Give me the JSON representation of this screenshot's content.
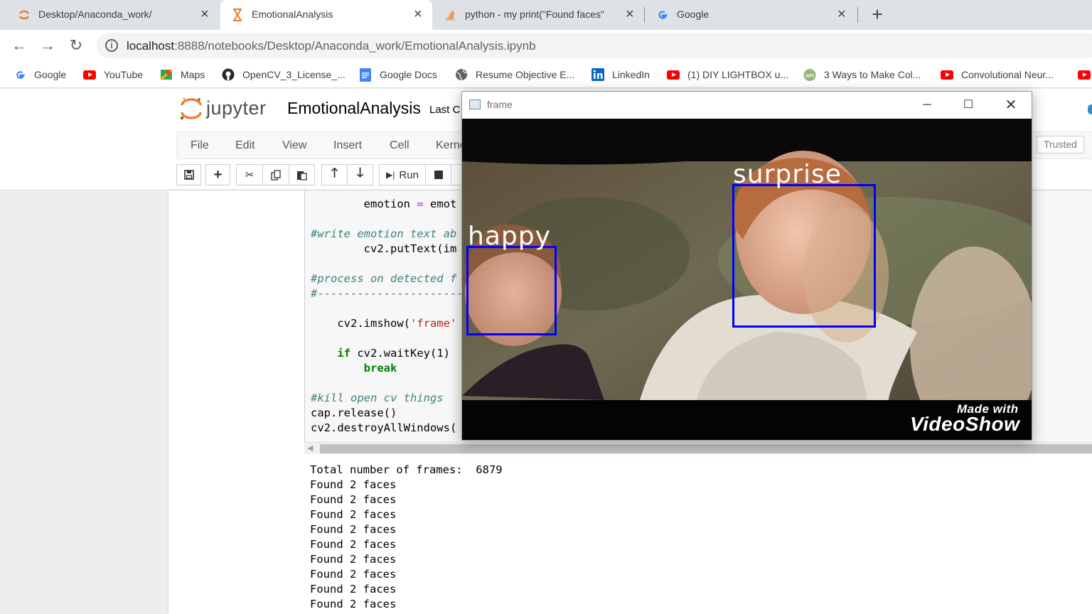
{
  "browser": {
    "tabs": [
      {
        "title": "Desktop/Anaconda_work/",
        "favicon": "jupyter-icon"
      },
      {
        "title": "EmotionalAnalysis",
        "favicon": "hourglass-icon",
        "active": true
      },
      {
        "title": "python - my print(\"Found faces\"",
        "favicon": "stackoverflow-icon"
      },
      {
        "title": "Google",
        "favicon": "google-icon"
      }
    ],
    "url_host": "localhost",
    "url_path": ":8888/notebooks/Desktop/Anaconda_work/EmotionalAnalysis.ipynb",
    "bookmarks": [
      {
        "label": "Google",
        "icon": "google-icon"
      },
      {
        "label": "YouTube",
        "icon": "youtube-icon"
      },
      {
        "label": "Maps",
        "icon": "maps-icon"
      },
      {
        "label": "OpenCV_3_License_...",
        "icon": "github-icon"
      },
      {
        "label": "Google Docs",
        "icon": "docs-icon"
      },
      {
        "label": "Resume Objective E...",
        "icon": "globe-icon"
      },
      {
        "label": "LinkedIn",
        "icon": "linkedin-icon"
      },
      {
        "label": "(1) DIY LIGHTBOX u...",
        "icon": "youtube-icon"
      },
      {
        "label": "3 Ways to Make Col...",
        "icon": "wikihow-icon"
      },
      {
        "label": "Convolutional Neur...",
        "icon": "youtube-icon"
      }
    ]
  },
  "jupyter": {
    "wordmark": "jupyter",
    "notebook_name": "EmotionalAnalysis",
    "checkpoint": "Last C",
    "menu": [
      "File",
      "Edit",
      "View",
      "Insert",
      "Cell",
      "Kerne"
    ],
    "trusted": "Trusted",
    "run_label": "Run"
  },
  "code_lines": [
    {
      "parts": [
        {
          "t": "        emotion "
        },
        {
          "t": "=",
          "c": "op"
        },
        {
          "t": " emot"
        }
      ]
    },
    {
      "parts": [
        {
          "t": "#write emotion text ab",
          "c": "cm"
        }
      ]
    },
    {
      "parts": [
        {
          "t": "        cv2.putText(im"
        }
      ]
    },
    {
      "parts": [
        {
          "t": "#process on detected f",
          "c": "cm"
        }
      ]
    },
    {
      "parts": [
        {
          "t": "#----------------------",
          "c": "cm"
        }
      ]
    },
    {
      "parts": [
        {
          "t": "    cv2.imshow("
        },
        {
          "t": "'frame'",
          "c": "str"
        }
      ]
    },
    {
      "parts": [
        {
          "t": "    "
        },
        {
          "t": "if",
          "c": "kw"
        },
        {
          "t": " cv2.waitKey(1)"
        }
      ]
    },
    {
      "parts": [
        {
          "t": "        "
        },
        {
          "t": "break",
          "c": "kw"
        }
      ]
    },
    {
      "parts": [
        {
          "t": "#kill open cv things",
          "c": "cm"
        }
      ]
    },
    {
      "parts": [
        {
          "t": "cap.release()"
        }
      ]
    },
    {
      "parts": [
        {
          "t": "cv2.destroyAllWindows("
        }
      ]
    }
  ],
  "output_lines": [
    "Total number of frames:  6879",
    "Found 2 faces",
    "Found 2 faces",
    "Found 2 faces",
    "Found 2 faces",
    "Found 2 faces",
    "Found 2 faces",
    "Found 2 faces",
    "Found 2 faces",
    "Found 2 faces"
  ],
  "cv_window": {
    "title": "frame",
    "labels": [
      "happy",
      "surprise"
    ],
    "watermark_top": "Made with",
    "watermark_bottom": "VideoShow",
    "box_color": "#0000ff"
  }
}
